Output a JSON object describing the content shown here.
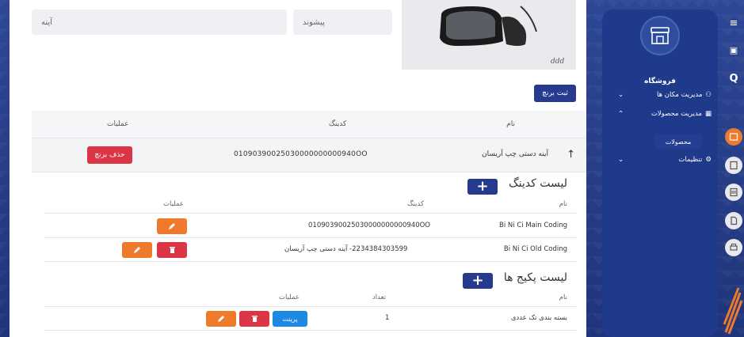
{
  "form": {
    "prefix_label": "پیشوند",
    "prefix_value": "آینه"
  },
  "actions": {
    "submit_brand": "ثبت برنچ"
  },
  "brand_table": {
    "headers": {
      "name": "نام",
      "coding": "کدینگ",
      "operations": "عملیات"
    },
    "row": {
      "name": "آینه دستی چپ آریسان",
      "coding": "01090390025030000000000940OO",
      "delete_label": "حذف برنچ"
    }
  },
  "coding_list": {
    "title": "لیست کدینگ",
    "headers": {
      "name": "نام",
      "coding": "کدینگ",
      "operations": "عملیات"
    },
    "rows": [
      {
        "name": "Bi Ni Ci Main Coding",
        "coding": "01090390025030000000000940OO"
      },
      {
        "name": "Bi Ni Ci Old Coding",
        "coding": "2234384303599- آینه دستی چپ آریسان"
      }
    ]
  },
  "package_list": {
    "title": "لیست پکیج ها",
    "headers": {
      "name": "نام",
      "count": "تعداد",
      "operations": "عملیات"
    },
    "rows": [
      {
        "name": "بسته بندی تک عددی",
        "count": "1",
        "print_label": "پرینت"
      }
    ]
  },
  "sidebar": {
    "title": "فروشگاه",
    "items": [
      {
        "label": "مدیریت مکان ها",
        "icon": "people-icon"
      },
      {
        "label": "مدیریت محصولات",
        "icon": "store-icon"
      },
      {
        "label": "تنظیمات",
        "icon": "gear-icon"
      }
    ],
    "active_sub": "محصولات"
  },
  "colors": {
    "primary": "#263b8e",
    "orange": "#f07a2c",
    "red": "#dc3545",
    "print_blue": "#1e88e5"
  }
}
